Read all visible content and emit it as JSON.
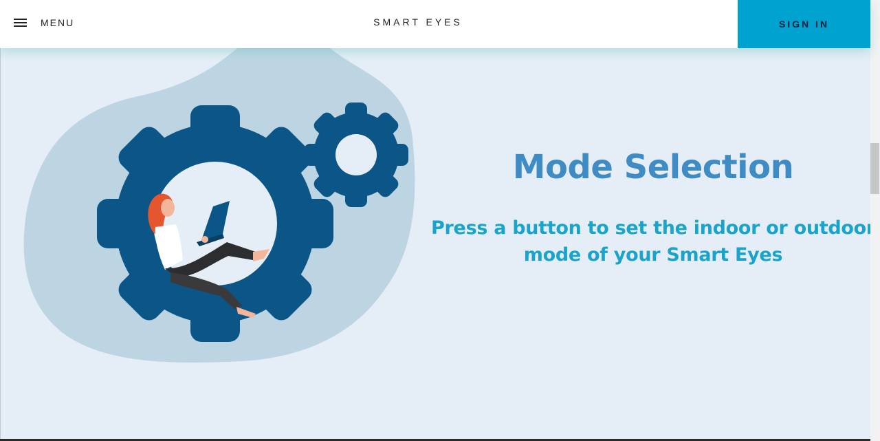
{
  "header": {
    "menu_label": "MENU",
    "brand": "SMART EYES",
    "signin_label": "SIGN IN"
  },
  "main": {
    "title": "Mode Selection",
    "subtitle": "Press a button to set the indoor or outdoor mode of your Smart Eyes"
  },
  "colors": {
    "accent": "#00a3cf",
    "title": "#3f8bc4",
    "subtitle": "#1aa4cc",
    "gear": "#0b5687",
    "blob": "#bdd5e2",
    "background": "#e5eef6"
  },
  "icons": [
    "hamburger-icon",
    "gear-icon"
  ]
}
